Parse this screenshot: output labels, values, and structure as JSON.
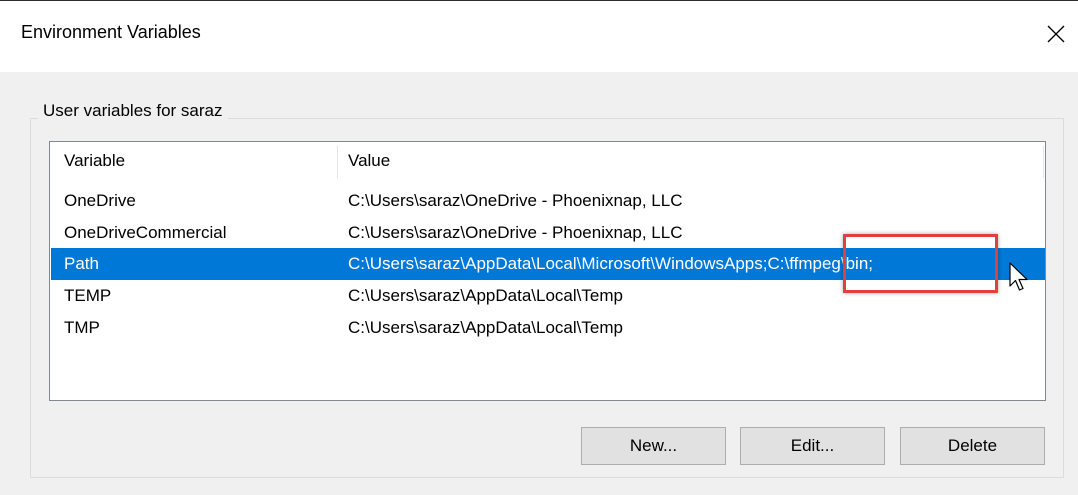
{
  "window": {
    "title": "Environment Variables"
  },
  "group": {
    "label": "User variables for saraz"
  },
  "table": {
    "columns": [
      "Variable",
      "Value"
    ],
    "rows": [
      {
        "variable": "OneDrive",
        "value": "C:\\Users\\saraz\\OneDrive - Phoenixnap, LLC"
      },
      {
        "variable": "OneDriveCommercial",
        "value": "C:\\Users\\saraz\\OneDrive - Phoenixnap, LLC"
      },
      {
        "variable": "Path",
        "value": "C:\\Users\\saraz\\AppData\\Local\\Microsoft\\WindowsApps;C:\\ffmpeg\\bin;"
      },
      {
        "variable": "TEMP",
        "value": "C:\\Users\\saraz\\AppData\\Local\\Temp"
      },
      {
        "variable": "TMP",
        "value": "C:\\Users\\saraz\\AppData\\Local\\Temp"
      }
    ],
    "selected_row": "Path"
  },
  "buttons": {
    "new_label": "New...",
    "edit_label": "Edit...",
    "delete_label": "Delete"
  },
  "colors": {
    "selection": "#0078d7",
    "highlight_box": "#e0403f"
  },
  "icons": {
    "close": "close-icon",
    "cursor": "mouse-pointer-icon"
  }
}
